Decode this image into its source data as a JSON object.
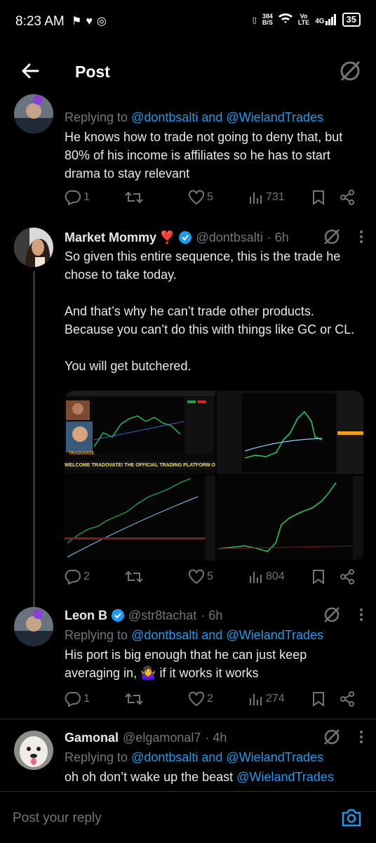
{
  "status_bar": {
    "time": "8:23 AM",
    "net_speed_value": "384",
    "net_speed_unit": "B/S",
    "volte_1": "Vo",
    "volte_2": "LTE",
    "network": "4G",
    "battery": "35"
  },
  "app_bar": {
    "title": "Post"
  },
  "tweets": [
    {
      "reply_prefix": "Replying to ",
      "reply_targets": "@dontbsalti and @WielandTrades",
      "text": "He knows how to trade not going to deny that, but 80% of his income is affiliates so he has to start drama to stay relevant",
      "replies": "1",
      "likes": "5",
      "views": "731"
    },
    {
      "name": "Market Mommy",
      "name_emoji": "❣️",
      "handle": "@dontbsalti",
      "time": "· 6h",
      "text": "So given this entire sequence, this is the trade he chose to take today.\n\nAnd that’s why he can’t trade other products. Because you can’t do this with things like GC or CL.\n\nYou will get butchered.",
      "media_banner": "WELCOME TRADOVATE! THE OFFICIAL TRADING PLATFORM OF THE BON!",
      "media_logo": "TRADOVATE",
      "replies": "2",
      "likes": "5",
      "views": "804"
    },
    {
      "name": "Leon B",
      "handle": "@str8tachat",
      "time": "· 6h",
      "reply_prefix": "Replying to ",
      "reply_targets": "@dontbsalti and @WielandTrades",
      "text": "His port is big enough that he can just keep averaging in, 🤷‍♀️ if it works it works",
      "replies": "1",
      "likes": "2",
      "views": "274"
    },
    {
      "name": "Gamonal",
      "handle": "@elgamonal7",
      "time": "· 4h",
      "reply_prefix": "Replying to ",
      "reply_targets": "@dontbsalti and @WielandTrades",
      "text": "oh oh don’t wake up the beast ",
      "text_link": "@WielandTrades"
    }
  ],
  "reply_bar": {
    "placeholder": "Post your reply"
  },
  "colors": {
    "accent": "#1d9bf0",
    "muted": "#71767b",
    "background": "#000000",
    "text": "#e7e9ea"
  },
  "icons": [
    "back-arrow-icon",
    "grok-icon",
    "reply-icon",
    "repost-icon",
    "like-icon",
    "views-icon",
    "bookmark-icon",
    "share-icon",
    "more-icon",
    "verified-icon",
    "camera-icon"
  ]
}
